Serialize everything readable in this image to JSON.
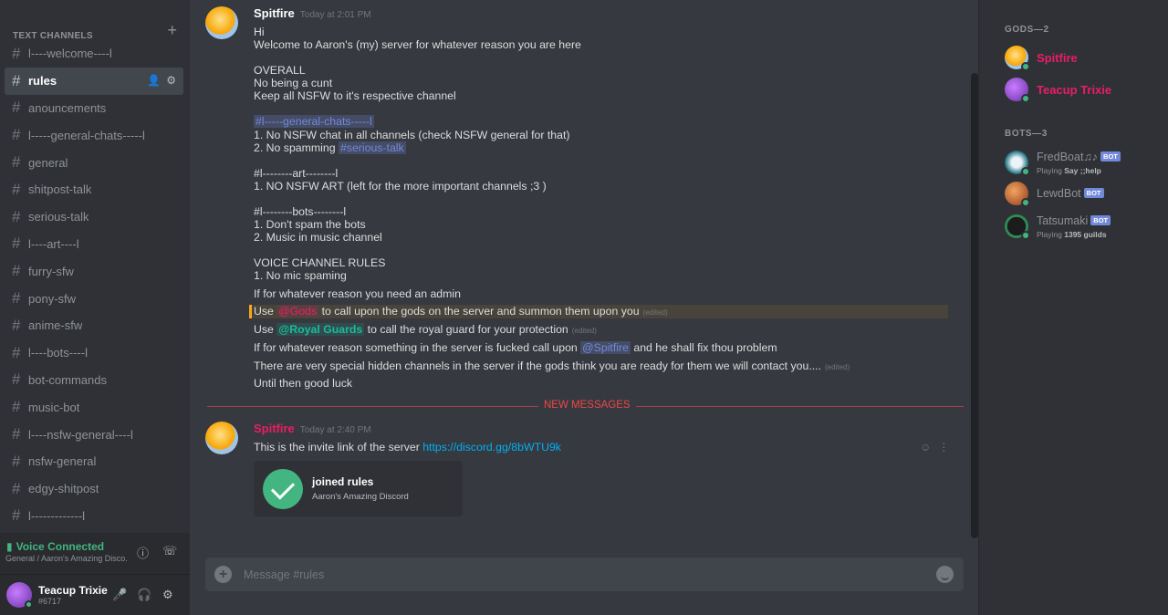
{
  "sidebar": {
    "header": "TEXT CHANNELS",
    "channels": [
      {
        "name": "l----welcome----l"
      },
      {
        "name": "rules"
      },
      {
        "name": "anouncements"
      },
      {
        "name": "l-----general-chats-----l"
      },
      {
        "name": "general"
      },
      {
        "name": "shitpost-talk"
      },
      {
        "name": "serious-talk"
      },
      {
        "name": "l----art----l"
      },
      {
        "name": "furry-sfw"
      },
      {
        "name": "pony-sfw"
      },
      {
        "name": "anime-sfw"
      },
      {
        "name": "l----bots----l"
      },
      {
        "name": "bot-commands"
      },
      {
        "name": "music-bot"
      },
      {
        "name": "l----nsfw-general----l"
      },
      {
        "name": "nsfw-general"
      },
      {
        "name": "edgy-shitpost"
      },
      {
        "name": "l-------------l"
      }
    ],
    "active_channel": "rules"
  },
  "voice": {
    "status": "Voice Connected",
    "location": "General / Aaron's Amazing Disco..."
  },
  "user": {
    "name": "Teacup Trixie",
    "tag": "#6717"
  },
  "messages": {
    "first": {
      "author": "Spitfire",
      "timestamp": "Today at 2:01 PM",
      "l01": "Hi",
      "l02": "Welcome to Aaron's (my) server for whatever reason you are here",
      "l03": "OVERALL",
      "l04": "No being a cunt",
      "l05": "Keep all NSFW to it's respective channel",
      "l06": "#l-----general-chats-----l",
      "l07": "1. No NSFW chat in all  channels (check NSFW general for that)",
      "l08a": "2. No spamming ",
      "l08b": "#serious-talk",
      "l09": "#l--------art--------l",
      "l10": "1. NO NSFW ART (left for the more important channels ;3 )",
      "l11": "#l--------bots--------l",
      "l12": "1. Don't spam the bots",
      "l13": "2. Music in music channel",
      "l14": "VOICE CHANNEL RULES",
      "l15": "1. No mic spaming",
      "l16": "If for whatever reason you need an admin",
      "l17a": "Use ",
      "l17b": "@Gods",
      "l17c": "  to call upon the gods on the server and summon them upon you",
      "l18a": "Use ",
      "l18b": "@Royal Guards",
      "l18c": "  to call the royal guard for your protection",
      "l19a": "If for whatever reason something in the server is fucked call upon ",
      "l19b": "@Spitfire",
      "l19c": " and he shall fix thou problem",
      "l20": "There are very special hidden channels in the server if the gods think you are ready for them we will contact you....",
      "l21": "Until then good luck",
      "edited": "(edited)"
    },
    "divider": "NEW MESSAGES",
    "second": {
      "author": "Spitfire",
      "timestamp": "Today at 2:40 PM",
      "text": "This is the invite link of the server ",
      "link": "https://discord.gg/8bWTU9k",
      "embed_title": "joined rules",
      "embed_sub": "Aaron's Amazing Discord"
    }
  },
  "input": {
    "placeholder": "Message #rules"
  },
  "members": {
    "gods_header": "GODS—2",
    "gods": [
      {
        "name": "Spitfire"
      },
      {
        "name": "Teacup Trixie"
      }
    ],
    "bots_header": "BOTS—3",
    "bots": [
      {
        "name": "FredBoat♫♪",
        "activity_prefix": "Playing ",
        "activity": "Say ;;help"
      },
      {
        "name": "LewdBot"
      },
      {
        "name": "Tatsumaki",
        "activity_prefix": "Playing ",
        "activity": "1395 guilds"
      }
    ],
    "bot_tag": "BOT"
  },
  "colors": {
    "accent": "#7289da",
    "gods_role": "#e91e63",
    "online": "#43b581",
    "new_messages": "#f04747"
  }
}
